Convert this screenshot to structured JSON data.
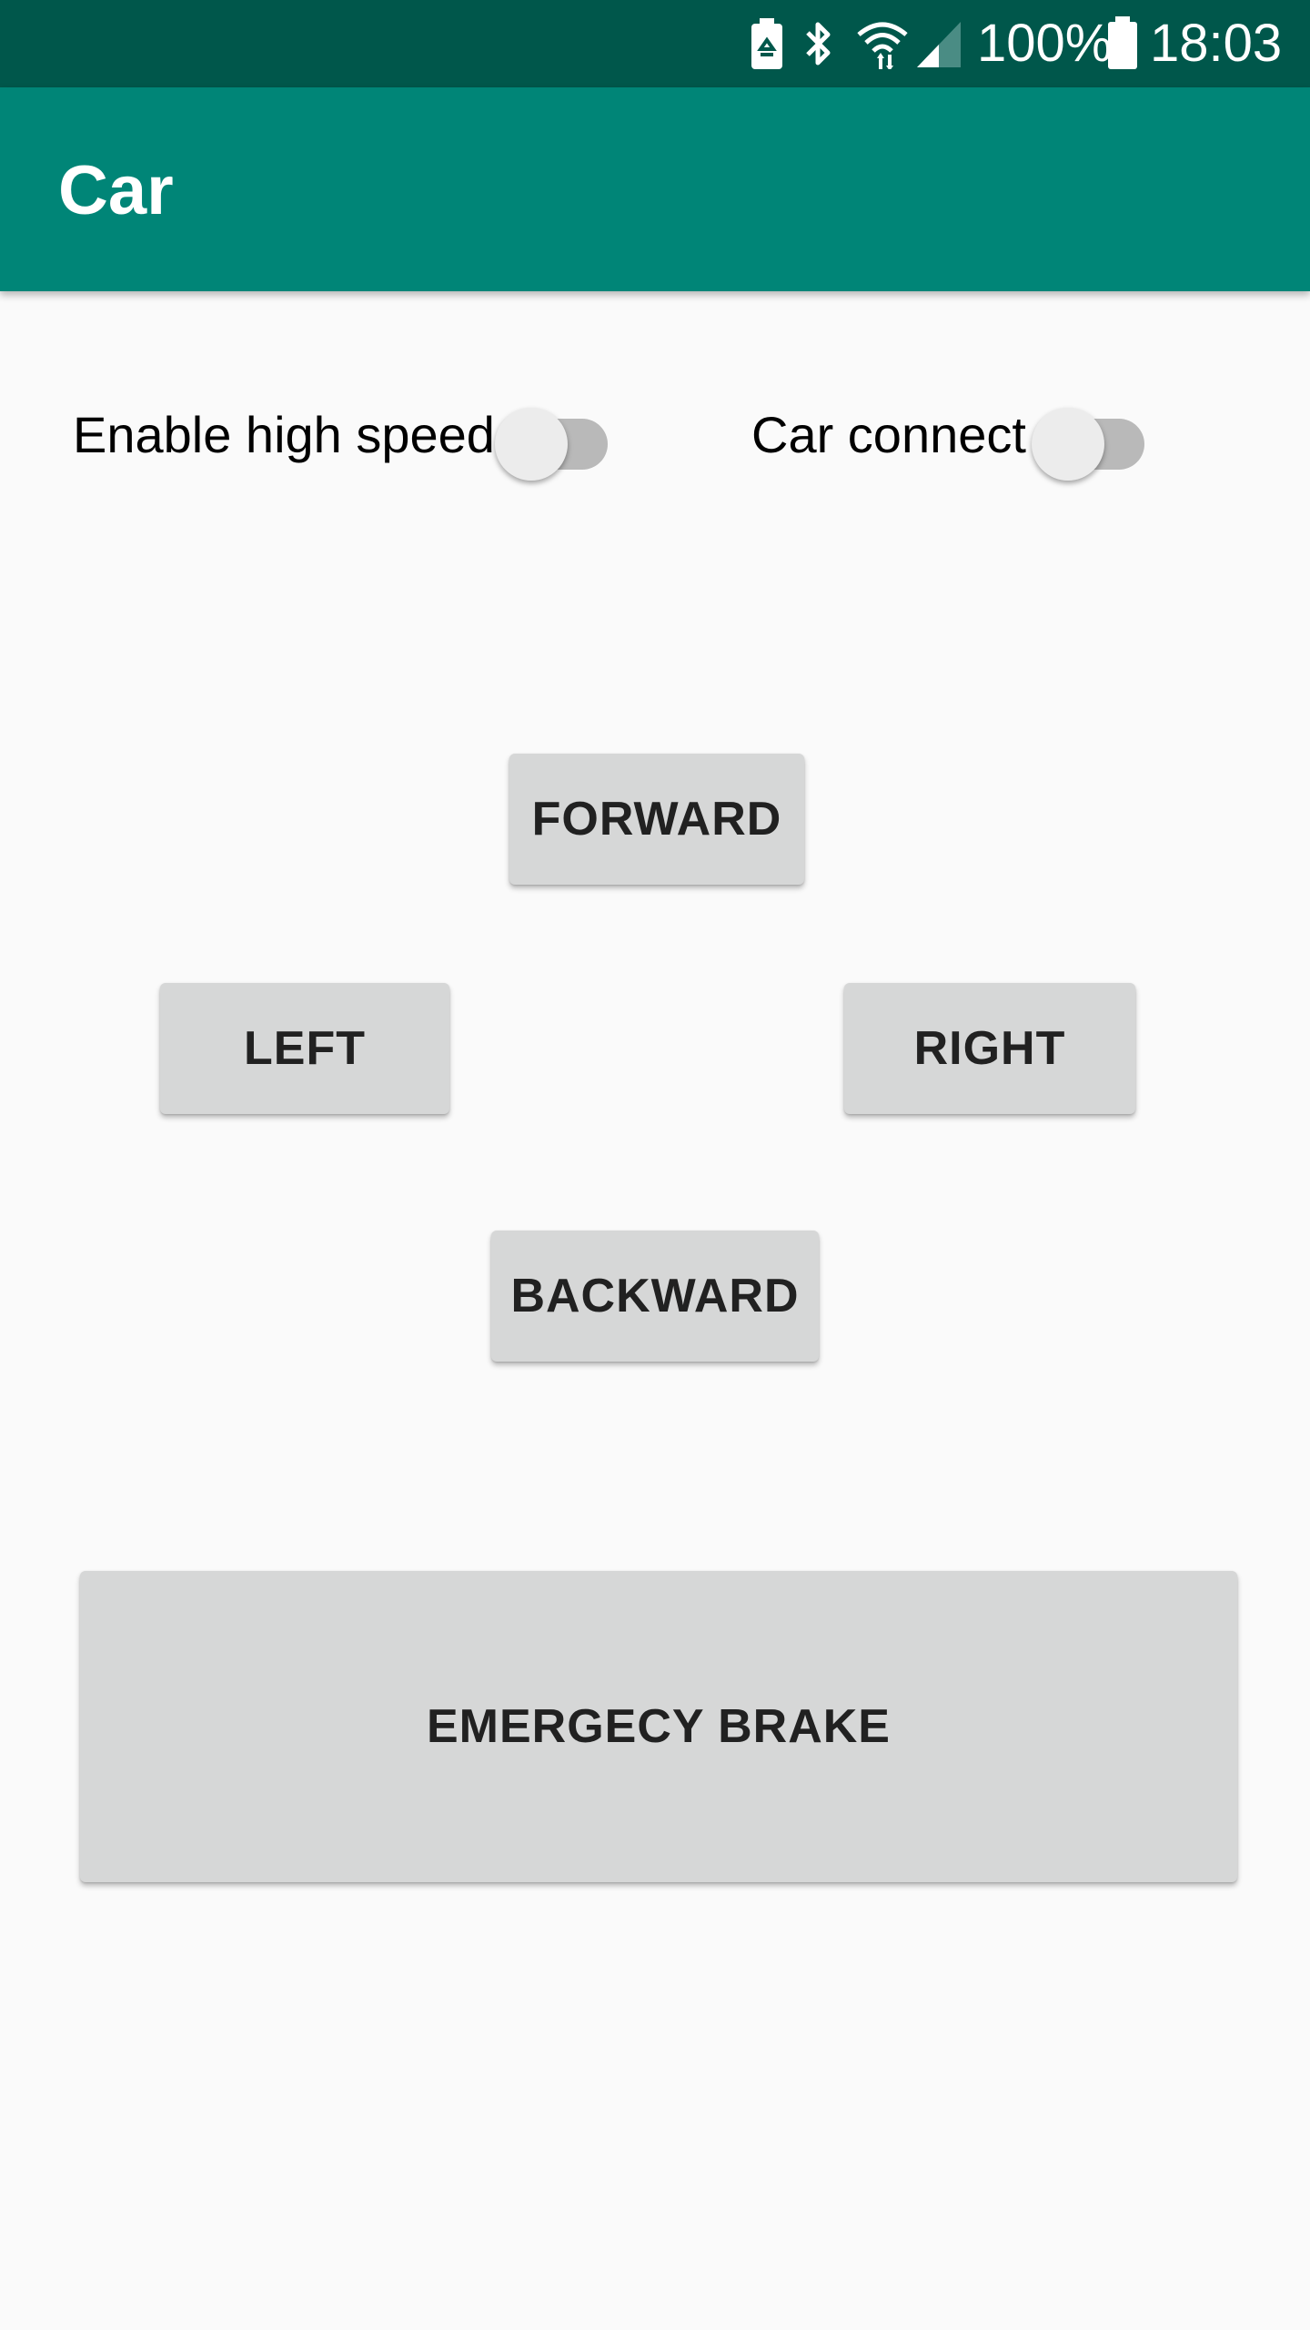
{
  "status_bar": {
    "battery_percent": "100%",
    "time": "18:03",
    "icons": [
      "battery-saver-icon",
      "bluetooth-icon",
      "wifi-icon",
      "cellular-signal-icon",
      "battery-icon"
    ],
    "background_color": "#00574b"
  },
  "app_bar": {
    "title": "Car",
    "background_color": "#008577"
  },
  "toggles": {
    "high_speed": {
      "label": "Enable high speed",
      "checked": false
    },
    "car_connect": {
      "label": "Car connect",
      "checked": false
    }
  },
  "controls": {
    "forward_label": "FORWARD",
    "left_label": "LEFT",
    "right_label": "RIGHT",
    "backward_label": "BACKWARD",
    "emergency_brake_label": "EMERGECY BRAKE"
  }
}
